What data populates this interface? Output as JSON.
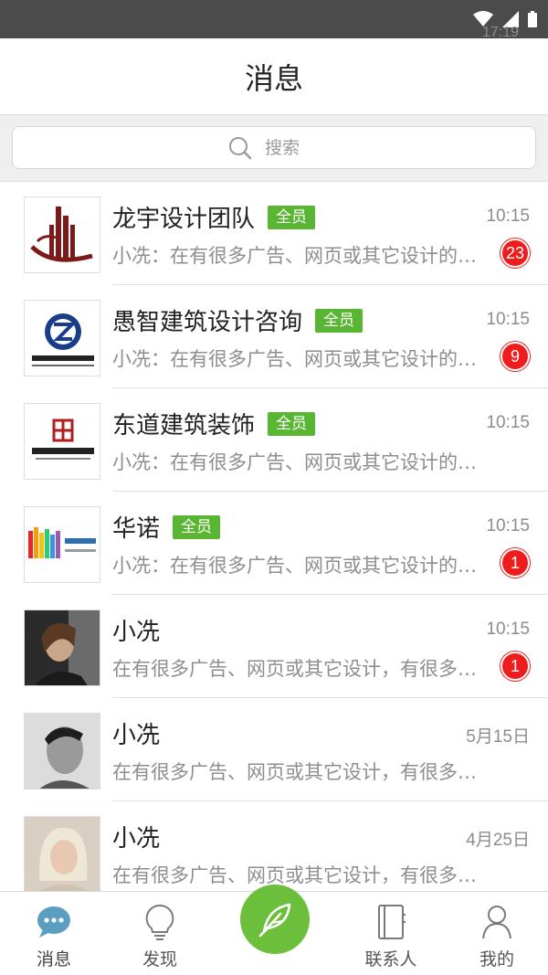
{
  "status_bar": {
    "time": "17:19"
  },
  "header": {
    "title": "消息"
  },
  "search": {
    "placeholder": "搜索"
  },
  "conversations": [
    {
      "name": "龙宇设计团队",
      "tag": "全员",
      "time": "10:15",
      "preview": "小冼：在有很多广告、网页或其它设计的内容",
      "unread": "23",
      "avatar": "logo-longyu"
    },
    {
      "name": "愚智建筑设计咨询",
      "tag": "全员",
      "time": "10:15",
      "preview": "小冼：在有很多广告、网页或其它设计的内容",
      "unread": "9",
      "avatar": "logo-yuzhi"
    },
    {
      "name": "东道建筑装饰",
      "tag": "全员",
      "time": "10:15",
      "preview": "小冼：在有很多广告、网页或其它设计的内容",
      "unread": "",
      "avatar": "logo-dongdao"
    },
    {
      "name": "华诺",
      "tag": "全员",
      "time": "10:15",
      "preview": "小冼：在有很多广告、网页或其它设计的内容",
      "unread": "1",
      "avatar": "logo-huanuo"
    },
    {
      "name": "小冼",
      "tag": "",
      "time": "10:15",
      "preview": "在有很多广告、网页或其它设计，有很多内容",
      "unread": "1",
      "avatar": "photo-woman"
    },
    {
      "name": "小冼",
      "tag": "",
      "time": "5月15日",
      "preview": "在有很多广告、网页或其它设计，有很多内容",
      "unread": "",
      "avatar": "photo-man"
    },
    {
      "name": "小冼",
      "tag": "",
      "time": "4月25日",
      "preview": "在有很多广告、网页或其它设计，有很多内容",
      "unread": "",
      "avatar": "photo-blonde"
    }
  ],
  "tabs": {
    "messages": "消息",
    "discover": "发现",
    "contacts": "联系人",
    "mine": "我的"
  },
  "colors": {
    "accent": "#6cbf3b",
    "badge": "#ee1c1c",
    "member_tag": "#58b632"
  }
}
